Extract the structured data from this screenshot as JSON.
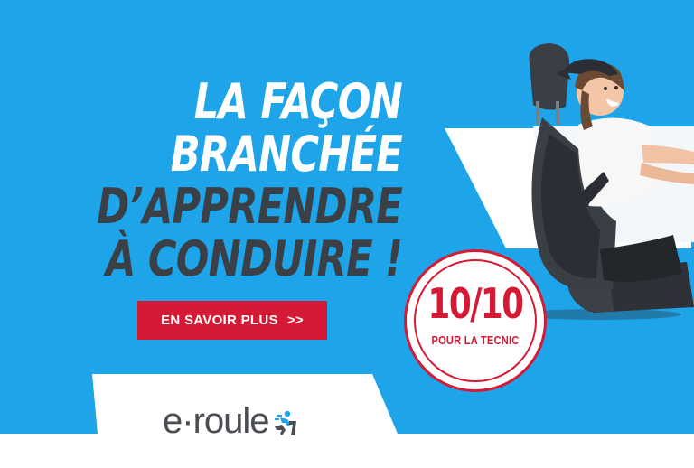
{
  "headline": {
    "line1": "LA FAÇON",
    "line2": "BRANCHÉE",
    "line3": "D’APPRENDRE",
    "line4": "À CONDUIRE !"
  },
  "cta": {
    "label": "EN SAVOIR PLUS",
    "arrows": ">>"
  },
  "badge": {
    "score": "10/10",
    "subtitle": "POUR LA TECNIC"
  },
  "logo": {
    "text": "e·roule",
    "icon": "driver-icon"
  },
  "colors": {
    "background_blue": "#1ea4e8",
    "accent_red": "#d51a35",
    "dark_text": "#3b3f46",
    "logo_gray": "#4a4d52",
    "logo_blue": "#1ea4e8"
  },
  "photo": {
    "subject": "smiling young woman in a car seat"
  }
}
